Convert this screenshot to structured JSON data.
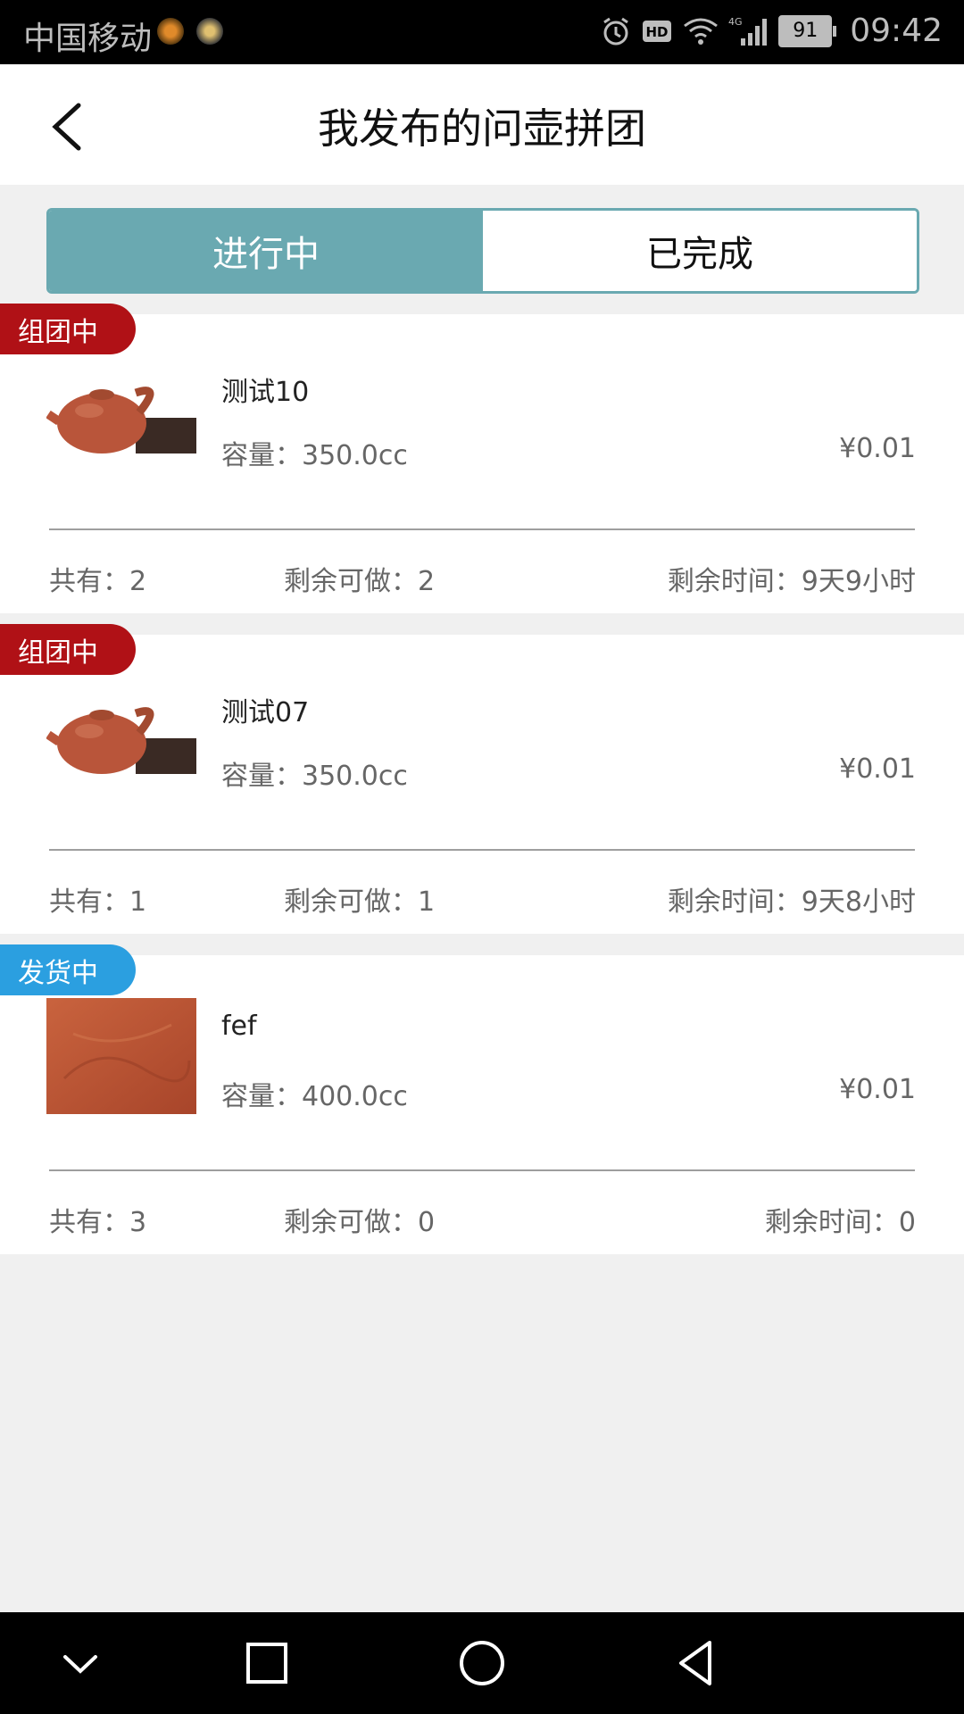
{
  "status_bar": {
    "carrier": "中国移动",
    "battery": "91",
    "time": "09:42",
    "icons": [
      "alarm-icon",
      "hd-icon",
      "wifi-icon",
      "signal-4g-icon"
    ]
  },
  "header": {
    "title": "我发布的问壶拼团",
    "back_icon": "chevron-left-icon"
  },
  "tabs": [
    {
      "label": "进行中",
      "active": true
    },
    {
      "label": "已完成",
      "active": false
    }
  ],
  "colors": {
    "accent": "#6aa9b1",
    "badge_forming": "#b01116",
    "badge_shipping": "#2b9fe0"
  },
  "cards": [
    {
      "badge": "组团中",
      "name": "测试10",
      "capacity": "容量：350.0cc",
      "price": "¥0.01",
      "total": "共有：2",
      "remaining": "剩余可做：2",
      "time_left": "剩余时间：9天9小时"
    },
    {
      "badge": "组团中",
      "name": "测试07",
      "capacity": "容量：350.0cc",
      "price": "¥0.01",
      "total": "共有：1",
      "remaining": "剩余可做：1",
      "time_left": "剩余时间：9天8小时"
    },
    {
      "badge": "发货中",
      "name": "fef",
      "capacity": "容量：400.0cc",
      "price": "¥0.01",
      "total": "共有：3",
      "remaining": "剩余可做：0",
      "time_left": "剩余时间：0"
    }
  ],
  "nav_bar": {
    "icons": [
      "chevron-down-icon",
      "square-icon",
      "circle-icon",
      "triangle-back-icon"
    ]
  }
}
